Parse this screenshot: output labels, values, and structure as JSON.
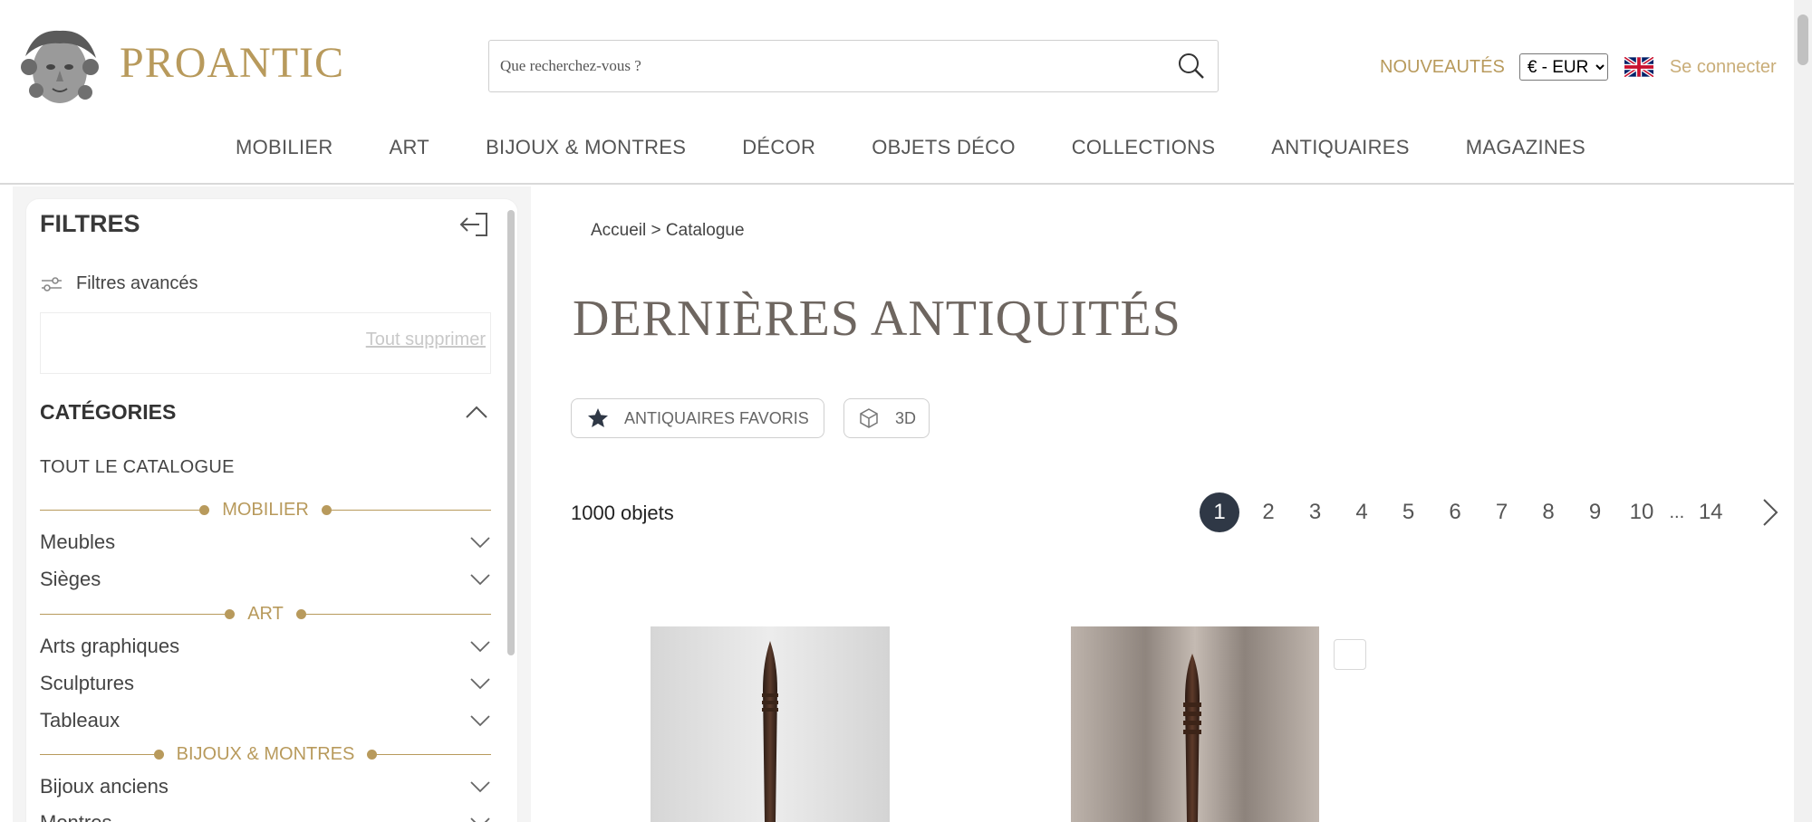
{
  "header": {
    "brand": "PROANTIC",
    "search_placeholder": "Que recherchez-vous ?",
    "nouveautes": "NOUVEAUTÉS",
    "currency": "€ - EUR",
    "login": "Se connecter"
  },
  "nav": [
    "MOBILIER",
    "ART",
    "BIJOUX & MONTRES",
    "DÉCOR",
    "OBJETS DÉCO",
    "COLLECTIONS",
    "ANTIQUAIRES",
    "MAGAZINES"
  ],
  "sidebar": {
    "title": "FILTRES",
    "advanced": "Filtres avancés",
    "clear_all": "Tout supprimer",
    "categories_title": "CATÉGORIES",
    "all_catalog": "TOUT LE CATALOGUE",
    "sections": {
      "mobilier": "MOBILIER",
      "art": "ART",
      "bijoux": "BIJOUX & MONTRES"
    },
    "items": {
      "meubles": "Meubles",
      "sieges": "Sièges",
      "arts_graphiques": "Arts graphiques",
      "sculptures": "Sculptures",
      "tableaux": "Tableaux",
      "bijoux_anciens": "Bijoux anciens",
      "montres": "Montres"
    }
  },
  "main": {
    "breadcrumb": "Accueil > Catalogue",
    "title": "DERNIÈRES ANTIQUITÉS",
    "fav_dealers": "ANTIQUAIRES FAVORIS",
    "view_3d": "3D",
    "count": "1000 objets",
    "pages": [
      "1",
      "2",
      "3",
      "4",
      "5",
      "6",
      "7",
      "8",
      "9",
      "10",
      "14"
    ],
    "ellipsis": "..."
  }
}
